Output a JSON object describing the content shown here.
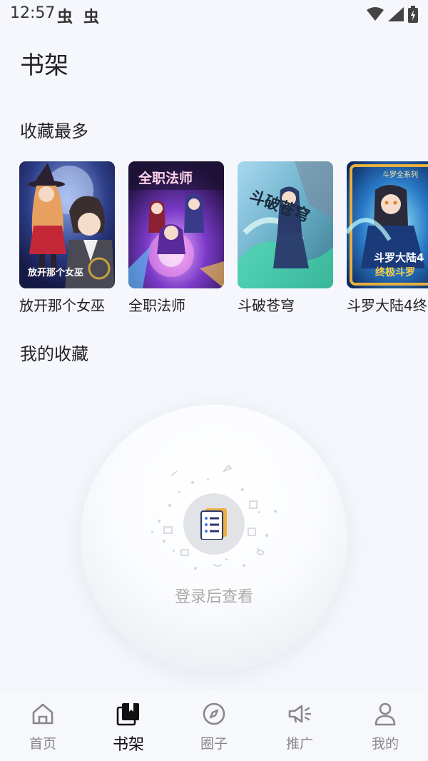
{
  "status_bar": {
    "time": "12:57",
    "notif_glyph_1": "虫",
    "notif_glyph_2": "虫",
    "icons": [
      "wifi-icon",
      "signal-icon",
      "battery-icon"
    ]
  },
  "page_title": "书架",
  "sections": {
    "most_favorited": "收藏最多",
    "my_favorites": "我的收藏"
  },
  "covers": [
    {
      "name": "放开那个女巫",
      "art_text": "放开那个女巫",
      "bg": "#2a3a7a"
    },
    {
      "name": "全职法师",
      "art_text": "全职法师",
      "bg": "#3a2a6a"
    },
    {
      "name": "斗破苍穹",
      "art_text": "斗破苍穹",
      "bg": "#4a7a9a"
    },
    {
      "name": "斗罗大陆4终",
      "art_text": "斗罗大陆4",
      "art_sub": "终极斗罗",
      "art_top": "斗罗全系列",
      "bg": "#1a4a8a"
    }
  ],
  "empty_state": {
    "text": "登录后查看"
  },
  "bottom_nav": [
    {
      "label": "首页",
      "icon": "home-icon",
      "active": false
    },
    {
      "label": "书架",
      "icon": "bookshelf-icon",
      "active": true
    },
    {
      "label": "圈子",
      "icon": "compass-icon",
      "active": false
    },
    {
      "label": "推广",
      "icon": "megaphone-icon",
      "active": false
    },
    {
      "label": "我的",
      "icon": "user-icon",
      "active": false
    }
  ],
  "colors": {
    "background": "#f5f7fc",
    "active_nav": "#111111",
    "inactive_nav": "#888888",
    "empty_text": "#aaaaaa"
  }
}
